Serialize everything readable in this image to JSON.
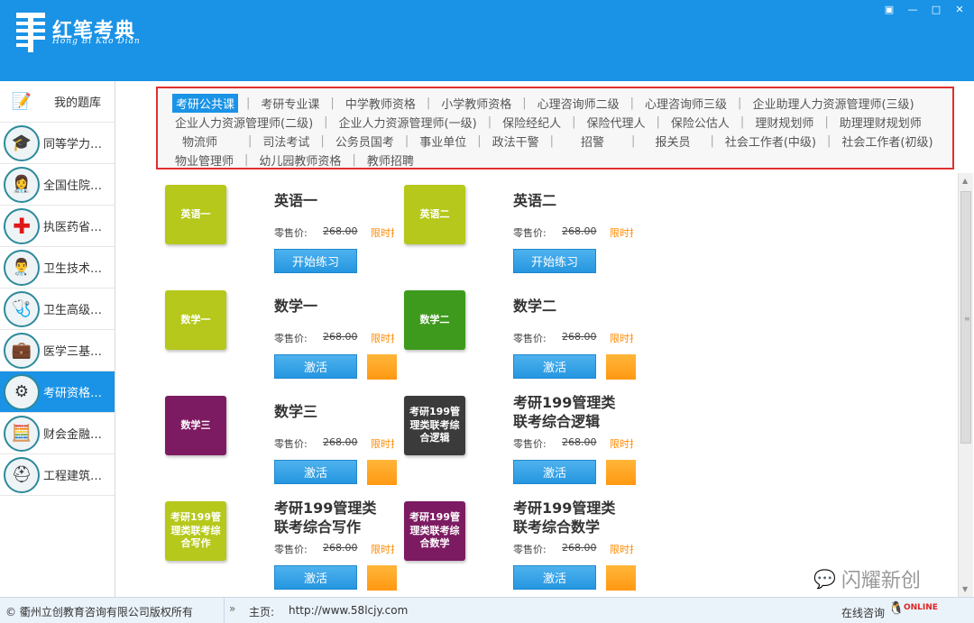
{
  "header": {
    "logo_title": "红笔考典",
    "logo_subtitle": "Hong Bi Kao Dian",
    "window_controls": [
      "▣",
      "—",
      "□",
      "✕"
    ]
  },
  "sidebar": {
    "items": [
      {
        "label": "我的题库",
        "icon": "📝"
      },
      {
        "label": "同等学力…",
        "icon": "🎓"
      },
      {
        "label": "全国住院…",
        "icon": "👩‍⚕️"
      },
      {
        "label": "执医药省…",
        "icon": "✚"
      },
      {
        "label": "卫生技术…",
        "icon": "👨‍⚕️"
      },
      {
        "label": "卫生高级…",
        "icon": "🩺"
      },
      {
        "label": "医学三基…",
        "icon": "💼"
      },
      {
        "label": "考研资格…",
        "icon": "⚙"
      },
      {
        "label": "财会金融…",
        "icon": "🧮"
      },
      {
        "label": "工程建筑…",
        "icon": "⛑"
      }
    ]
  },
  "tabs": {
    "rows": [
      [
        "考研公共课",
        "考研专业课",
        "中学教师资格",
        "小学教师资格",
        "心理咨询师二级",
        "心理咨询师三级",
        "企业助理人力资源管理师(三级)"
      ],
      [
        "企业人力资源管理师(二级)",
        "企业人力资源管理师(一级)",
        "保险经纪人",
        "保险代理人",
        "保险公估人",
        "理财规划师",
        "助理理财规划师"
      ],
      [
        "物流师",
        "司法考试",
        "公务员国考",
        "事业单位",
        "政法干警",
        "招警",
        "报关员",
        "社会工作者(中级)",
        "社会工作者(初级)"
      ],
      [
        "物业管理师",
        "幼儿园教师资格",
        "教师招聘"
      ]
    ],
    "active": "考研公共课"
  },
  "courses": [
    {
      "thumb": "英语一",
      "title": "英语一",
      "price_label": "零售价:",
      "price": "268.00",
      "promo": "限时折扣",
      "button": "开始练习",
      "thumb_color": "lime",
      "orange": false
    },
    {
      "thumb": "英语二",
      "title": "英语二",
      "price_label": "零售价:",
      "price": "268.00",
      "promo": "限时折扣",
      "button": "开始练习",
      "thumb_color": "lime",
      "orange": false
    },
    {
      "thumb": "数学一",
      "title": "数学一",
      "price_label": "零售价:",
      "price": "268.00",
      "promo": "限时折扣",
      "button": "激活",
      "thumb_color": "lime",
      "orange": true
    },
    {
      "thumb": "数学二",
      "title": "数学二",
      "price_label": "零售价:",
      "price": "268.00",
      "promo": "限时折扣",
      "button": "激活",
      "thumb_color": "green",
      "orange": true
    },
    {
      "thumb": "数学三",
      "title": "数学三",
      "price_label": "零售价:",
      "price": "268.00",
      "promo": "限时折扣",
      "button": "激活",
      "thumb_color": "purple",
      "orange": true
    },
    {
      "thumb": "考研199管理类联考综合逻辑",
      "title": "考研199管理类联考综合逻辑",
      "price_label": "零售价:",
      "price": "268.00",
      "promo": "限时折扣",
      "button": "激活",
      "thumb_color": "dark",
      "orange": true
    },
    {
      "thumb": "考研199管理类联考综合写作",
      "title": "考研199管理类联考综合写作",
      "price_label": "零售价:",
      "price": "268.00",
      "promo": "限时折扣",
      "button": "激活",
      "thumb_color": "lime",
      "orange": true
    },
    {
      "thumb": "考研199管理类联考综合数学",
      "title": "考研199管理类联考综合数学",
      "price_label": "零售价:",
      "price": "268.00",
      "promo": "限时折扣",
      "button": "激活",
      "thumb_color": "purple",
      "orange": true
    }
  ],
  "watermark": "闪耀新创",
  "footer": {
    "copyright": "© 衢州立创教育咨询有限公司版权所有",
    "home_label": "主页:",
    "home_url": "http://www.58lcjy.com",
    "consult": "在线咨询",
    "online_badge": "ONLINE"
  },
  "colors": {
    "primary": "#1a93e6",
    "highlight_border": "#e03030",
    "promo": "#ff8a00",
    "button": "#2596e0"
  }
}
